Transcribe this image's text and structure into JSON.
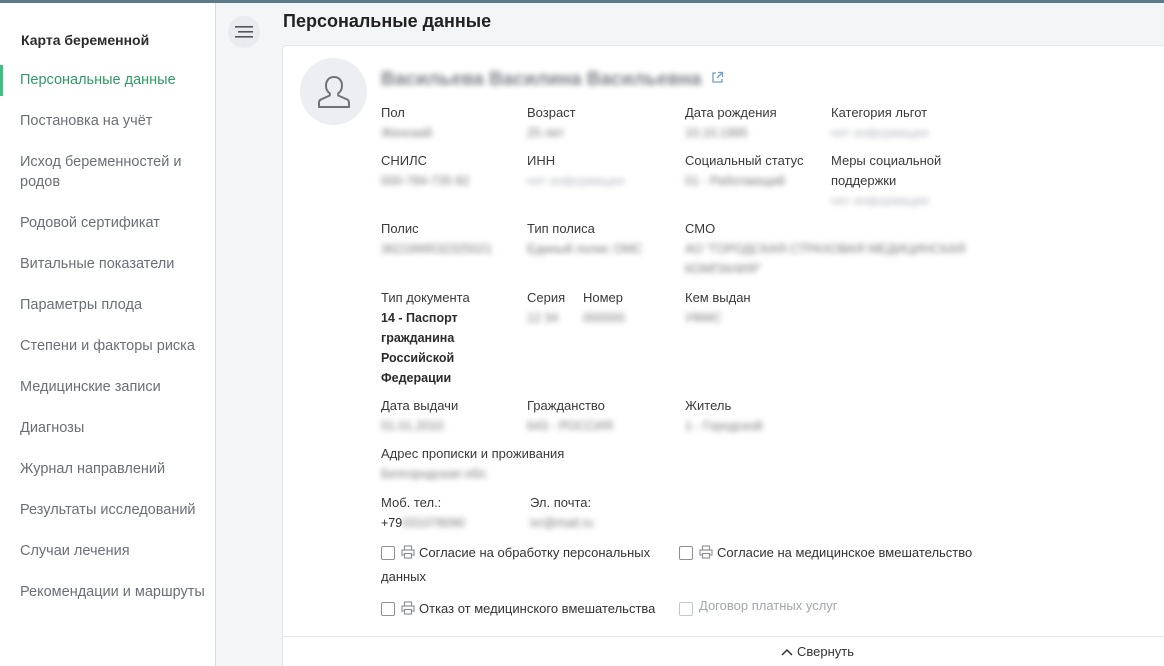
{
  "sidebar": {
    "title": "Карта беременной",
    "items": [
      {
        "label": "Персональные данные"
      },
      {
        "label": "Постановка на учёт"
      },
      {
        "label": "Исход беременностей и родов"
      },
      {
        "label": "Родовой сертификат"
      },
      {
        "label": "Витальные показатели"
      },
      {
        "label": "Параметры плода"
      },
      {
        "label": "Степени и факторы риска"
      },
      {
        "label": "Медицинские записи"
      },
      {
        "label": "Диагнозы"
      },
      {
        "label": "Журнал направлений"
      },
      {
        "label": "Результаты исследований"
      },
      {
        "label": "Случаи лечения"
      },
      {
        "label": "Рекомендации и маршруты"
      }
    ]
  },
  "header": {
    "title": "Персональные данные"
  },
  "patient": {
    "fio": "Васильева Василина Васильевна",
    "fields": {
      "gender": {
        "label": "Пол",
        "value": "Женский"
      },
      "age": {
        "label": "Возраст",
        "value": "25 лет"
      },
      "birth_date": {
        "label": "Дата рождения",
        "value": "10.10.1995"
      },
      "benefits": {
        "label": "Категория льгот",
        "value": "нет информации"
      },
      "snils": {
        "label": "СНИЛС",
        "value": "000-784-735 82"
      },
      "inn": {
        "label": "ИНН",
        "value": "нет информации"
      },
      "social_status": {
        "label": "Социальный статус",
        "value": "01 - Работающий"
      },
      "social_support": {
        "label": "Меры социальной поддержки",
        "value": "нет информации"
      },
      "policy": {
        "label": "Полис",
        "value": "3621999532325021"
      },
      "policy_type": {
        "label": "Тип полиса",
        "value": "Единый полис ОМС"
      },
      "smo": {
        "label": "СМО",
        "value": "АО \"ГОРОДСКАЯ СТРАХОВАЯ МЕДИЦИНСКАЯ КОМПАНИЯ\""
      },
      "doc_type": {
        "label": "Тип документа",
        "value": "14 - Паспорт гражданина Российской Федерации"
      },
      "doc_series": {
        "label": "Серия",
        "value": "12 34"
      },
      "doc_number": {
        "label": "Номер",
        "value": "000000"
      },
      "issued_by": {
        "label": "Кем выдан",
        "value": "УФМС"
      },
      "issue_date": {
        "label": "Дата выдачи",
        "value": "01.01.2010"
      },
      "citizenship": {
        "label": "Гражданство",
        "value": "643 - РОССИЯ"
      },
      "resident": {
        "label": "Житель",
        "value": "1 - Городской"
      },
      "address": {
        "label": "Адрес прописки и проживания",
        "value": "Белгородская обл."
      },
      "mobile": {
        "label": "Моб. тел.:",
        "prefix": "+79",
        "value": "031078090"
      },
      "email": {
        "label": "Эл. почта:",
        "value": "ivr@mail.ru"
      }
    }
  },
  "consents": {
    "personal_data": "Согласие на обработку персональных",
    "personal_data_cont": "данных",
    "medical_intervention": "Согласие на медицинское вмешательство",
    "refusal": "Отказ от медицинского вмешательства",
    "paid_services": "Договор платных услуг"
  },
  "footer": {
    "collapse_label": "Свернуть"
  },
  "colors": {
    "accent": "#3fbf7f",
    "active_text": "#2f9a67"
  }
}
